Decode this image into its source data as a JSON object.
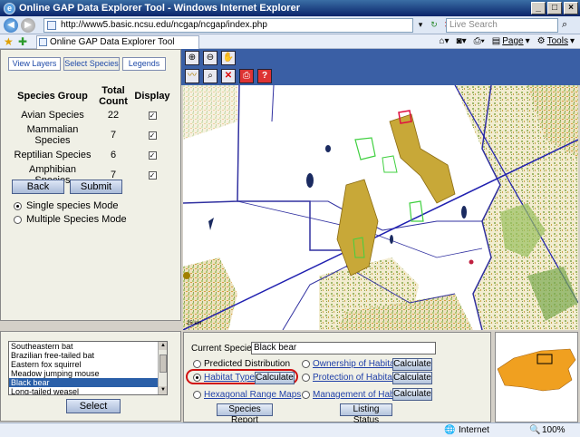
{
  "window": {
    "title": "Online GAP Data Explorer Tool - Windows Internet Explorer",
    "url": "http://www5.basic.ncsu.edu/ncgap/ncgap/index.php",
    "search_placeholder": "Live Search",
    "tab_title": "Online GAP Data Explorer Tool",
    "commands": [
      "Page",
      "Tools"
    ]
  },
  "left_panel": {
    "tabs": [
      "View Layers",
      "Select Species",
      "Legends"
    ],
    "active_tab": "Select Species",
    "table_headers": {
      "group": "Species Group",
      "count": "Total Count",
      "display": "Display"
    },
    "rows": [
      {
        "group": "Avian Species",
        "count": "22",
        "checked": true
      },
      {
        "group": "Mammalian Species",
        "count": "7",
        "checked": true
      },
      {
        "group": "Reptilian Species",
        "count": "6",
        "checked": true
      },
      {
        "group": "Amphibian Species",
        "count": "7",
        "checked": true
      }
    ],
    "back_label": "Back",
    "submit_label": "Submit",
    "mode_single": "Single species Mode",
    "mode_multiple": "Multiple Species Mode",
    "selected_mode": "single"
  },
  "species_list": {
    "items": [
      "Southeastern bat",
      "Brazilian free-tailed bat",
      "Eastern fox squirrel",
      "Meadow jumping mouse",
      "Black bear",
      "Long-tailed weasel"
    ],
    "selected": "Black bear",
    "select_label": "Select"
  },
  "map": {
    "scale_label": "25 km"
  },
  "calc_panel": {
    "current_species_label": "Current Species:",
    "current_species_value": "Black bear",
    "predicted_distribution": "Predicted Distribution",
    "habitat_types": "Habitat Types",
    "hexagonal_range_maps": "Hexagonal Range Maps",
    "ownership_of_habitat": "Ownership of Habitat",
    "protection_of_habitat": "Protection of Habitat",
    "management_of_habitat": "Management of Habitat",
    "calculate_label": "Calculate",
    "species_report_label": "Species Report",
    "listing_status_label": "Listing Status",
    "selected_option": "habitat_types"
  },
  "status": {
    "zone": "Internet",
    "zoom": "100%"
  },
  "colors": {
    "map_toolbar": "#3a5fa5",
    "link": "#1f3fa8",
    "highlight_oval": "#d01010",
    "list_selection": "#2a5fa8"
  }
}
